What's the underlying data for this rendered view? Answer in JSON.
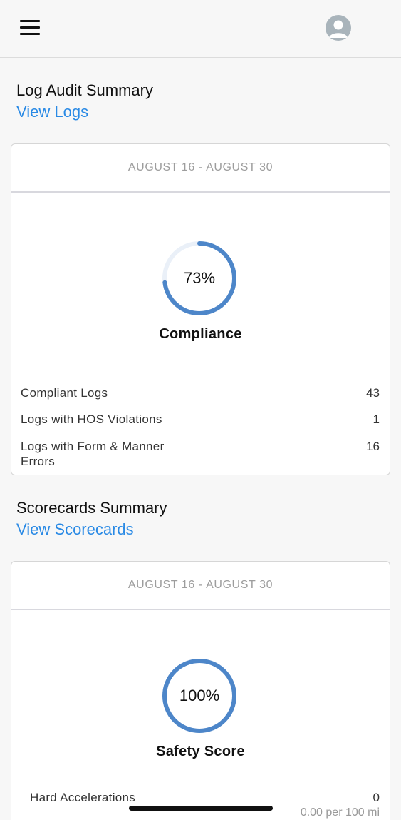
{
  "header": {
    "menu_icon": "hamburger-menu-icon",
    "avatar_icon": "user-avatar-icon"
  },
  "log_audit": {
    "title": "Log Audit Summary",
    "link": "View Logs",
    "date_range": "AUGUST 16 - AUGUST 30",
    "gauge": {
      "percent_text": "73%",
      "percent": 73,
      "label": "Compliance",
      "color": "#4d86c9",
      "track_color": "#eaf0f8"
    },
    "stats": [
      {
        "name": "Compliant Logs",
        "value": "43"
      },
      {
        "name": "Logs with HOS Violations",
        "value": "1"
      },
      {
        "name": "Logs with Form & Manner Errors",
        "value": "16"
      }
    ]
  },
  "scorecards": {
    "title": "Scorecards Summary",
    "link": "View Scorecards",
    "date_range": "AUGUST 16 - AUGUST 30",
    "gauge": {
      "percent_text": "100%",
      "percent": 100,
      "label": "Safety Score",
      "color": "#4d86c9",
      "track_color": "#eaf0f8"
    },
    "stats": [
      {
        "name": "Hard Accelerations",
        "value": "0",
        "sub": "0.00 per 100 mi"
      }
    ]
  },
  "colors": {
    "link": "#2a8ae5",
    "gauge": "#4d86c9",
    "background": "#f7f7f7"
  }
}
